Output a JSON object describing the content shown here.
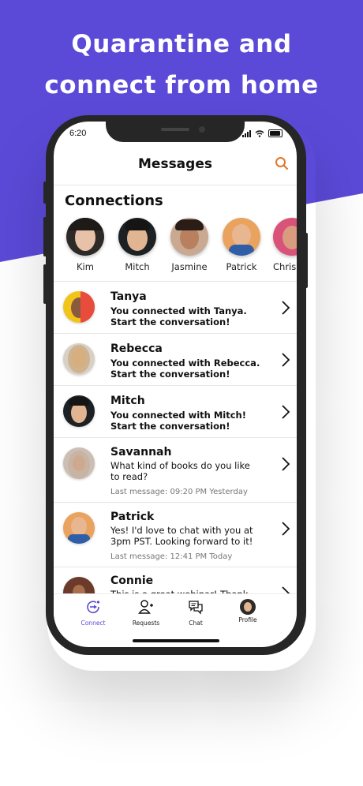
{
  "headline": {
    "line1": "Quarantine and",
    "line2": "connect from home"
  },
  "colors": {
    "brand": "#5b4ad8",
    "search_accent": "#e0762a"
  },
  "status_bar": {
    "time": "6:20"
  },
  "header": {
    "title": "Messages",
    "search_icon": "search-icon"
  },
  "connections": {
    "title": "Connections",
    "people": [
      {
        "name": "Kim"
      },
      {
        "name": "Mitch"
      },
      {
        "name": "Jasmine"
      },
      {
        "name": "Patrick"
      },
      {
        "name": "Chris"
      }
    ]
  },
  "messages": [
    {
      "name": "Tanya",
      "line1": "You connected with Tanya.",
      "line2": "Start the conversation!"
    },
    {
      "name": "Rebecca",
      "line1": "You connected with Rebecca.",
      "line2": "Start the conversation!"
    },
    {
      "name": "Mitch",
      "line1": "You connected with Mitch!",
      "line2": "Start the conversation!"
    },
    {
      "name": "Savannah",
      "line1": "What kind of books do you like",
      "line2": "to read?",
      "time": "Last message: 09:20 PM Yesterday"
    },
    {
      "name": "Patrick",
      "line1": "Yes! I'd love to chat with you at",
      "line2": "3pm PST. Looking forward to it!",
      "time": "Last message: 12:41 PM Today"
    },
    {
      "name": "Connie",
      "line1": "This is a great webinar! Thank"
    }
  ],
  "tabs": [
    {
      "label": "Connect",
      "icon": "connect-icon",
      "active": true
    },
    {
      "label": "Requests",
      "icon": "add-user-icon"
    },
    {
      "label": "Chat",
      "icon": "chat-icon"
    },
    {
      "label": "Profile",
      "icon": "avatar"
    }
  ]
}
